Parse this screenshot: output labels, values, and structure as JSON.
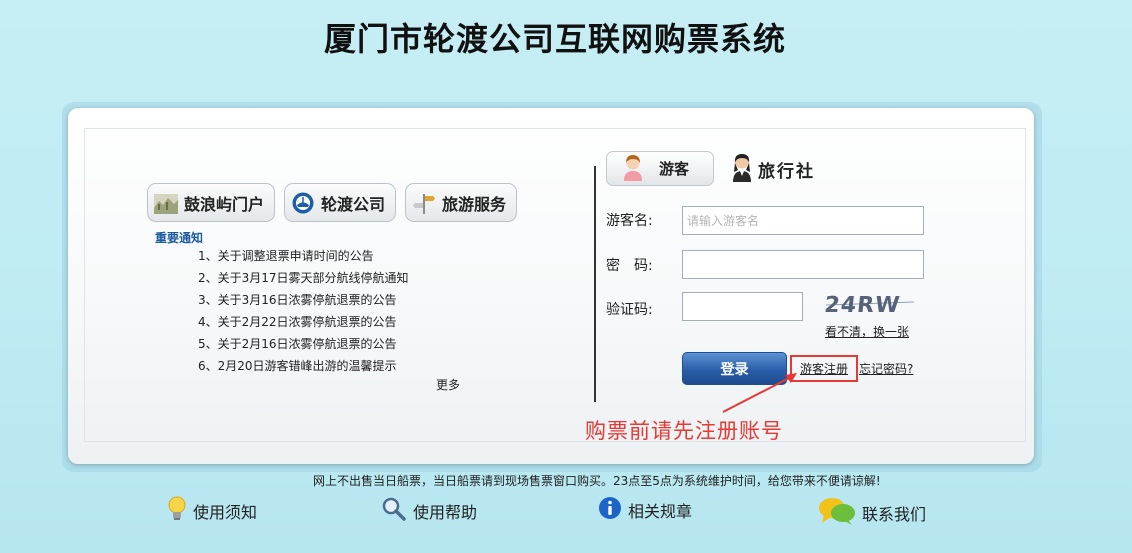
{
  "page": {
    "title": "厦门市轮渡公司互联网购票系统"
  },
  "quick_links": [
    {
      "label": "鼓浪屿门户",
      "icon": "gulangyu-landscape-icon"
    },
    {
      "label": "轮渡公司",
      "icon": "ferry-company-logo-icon"
    },
    {
      "label": "旅游服务",
      "icon": "signpost-icon"
    }
  ],
  "notices": {
    "title": "重要通知",
    "items": [
      "1、关于调整退票申请时间的公告",
      "2、关于3月17日雾天部分航线停航通知",
      "3、关于3月16日浓雾停航退票的公告",
      "4、关于2月22日浓雾停航退票的公告",
      "5、关于2月16日浓雾停航退票的公告",
      "6、2月20日游客错峰出游的温馨提示"
    ],
    "more": "更多"
  },
  "login": {
    "tabs": {
      "visitor": "游客",
      "agency": "旅行社"
    },
    "username_label": "游客名:",
    "username_placeholder": "请输入游客名",
    "username_value": "",
    "password_label": "密　码:",
    "password_value": "",
    "captcha_label": "验证码:",
    "captcha_value": "",
    "captcha_text": "24RW",
    "captcha_refresh": "看不清，换一张",
    "submit": "登录",
    "register": "游客注册",
    "forgot": "忘记密码?"
  },
  "annotation": {
    "text": "购票前请先注册账号",
    "color": "#e53935"
  },
  "footer": {
    "note": "网上不出售当日船票，当日船票请到现场售票窗口购买。23点至5点为系统维护时间，给您带来不便请谅解!",
    "links": [
      {
        "label": "使用须知",
        "icon": "lightbulb-icon"
      },
      {
        "label": "使用帮助",
        "icon": "magnifier-icon"
      },
      {
        "label": "相关规章",
        "icon": "info-icon"
      },
      {
        "label": "联系我们",
        "icon": "chat-bubbles-icon"
      }
    ]
  }
}
